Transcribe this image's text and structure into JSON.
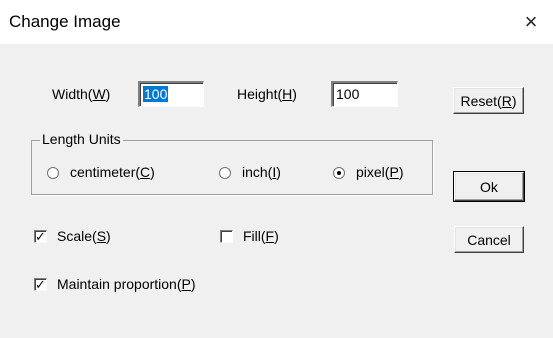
{
  "window": {
    "title": "Change Image",
    "close_glyph": "×"
  },
  "size": {
    "width_label": "Width(W)",
    "width_value": "100",
    "height_label": "Height(H)",
    "height_value": "100"
  },
  "units": {
    "group_label": "Length Units",
    "options": [
      "centimeter(C)",
      "inch(I)",
      "pixel(P)"
    ],
    "selected": "pixel(P)"
  },
  "options": {
    "scale_label": "Scale(S)",
    "scale_checked": true,
    "fill_label": "Fill(F)",
    "fill_checked": false,
    "maintain_label": "Maintain proportion(P)",
    "maintain_checked": true
  },
  "buttons": {
    "reset": "Reset(R)",
    "ok": "Ok",
    "cancel": "Cancel"
  }
}
